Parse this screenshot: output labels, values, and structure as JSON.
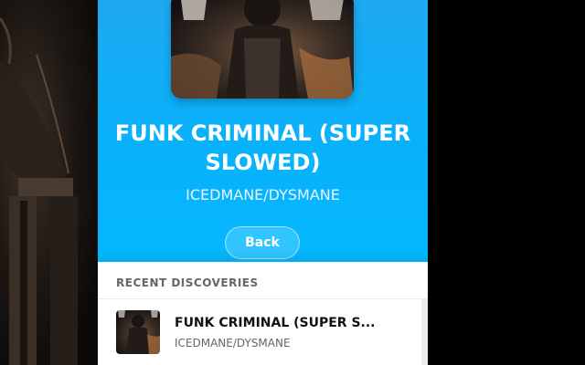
{
  "now_playing": {
    "title": "FUNK CRIMINAL (SUPER SLOWED)",
    "artist": "ICEDMANE/DYSMANE",
    "back_label": "Back",
    "cover_icon": "album-cover-image"
  },
  "recent": {
    "header": "RECENT DISCOVERIES",
    "items": [
      {
        "title": "FUNK CRIMINAL (SUPER S...",
        "artist": "ICEDMANE/DYSMANE",
        "thumb_icon": "album-thumbnail-image"
      }
    ]
  },
  "colors": {
    "hero_gradient_top": "#1ea9f2",
    "hero_gradient_bottom": "#05b8ff",
    "title_text": "#ffffff",
    "list_title_text": "#111111",
    "list_subtitle_text": "#666666"
  }
}
